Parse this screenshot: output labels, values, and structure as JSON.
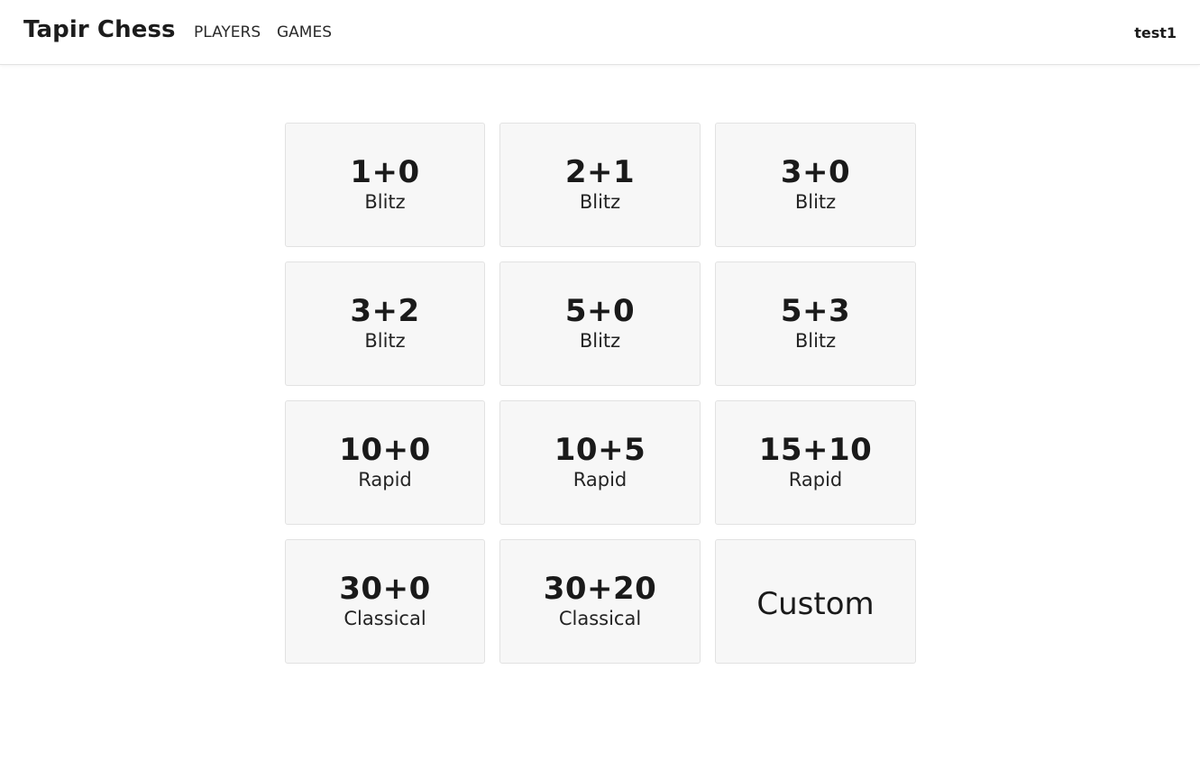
{
  "app": {
    "brand": "Tapir Chess",
    "nav": {
      "players": "PLAYERS",
      "games": "GAMES"
    },
    "user": "test1"
  },
  "time_controls": [
    {
      "time": "1+0",
      "type": "Blitz"
    },
    {
      "time": "2+1",
      "type": "Blitz"
    },
    {
      "time": "3+0",
      "type": "Blitz"
    },
    {
      "time": "3+2",
      "type": "Blitz"
    },
    {
      "time": "5+0",
      "type": "Blitz"
    },
    {
      "time": "5+3",
      "type": "Blitz"
    },
    {
      "time": "10+0",
      "type": "Rapid"
    },
    {
      "time": "10+5",
      "type": "Rapid"
    },
    {
      "time": "15+10",
      "type": "Rapid"
    },
    {
      "time": "30+0",
      "type": "Classical"
    },
    {
      "time": "30+20",
      "type": "Classical"
    }
  ],
  "custom_label": "Custom"
}
